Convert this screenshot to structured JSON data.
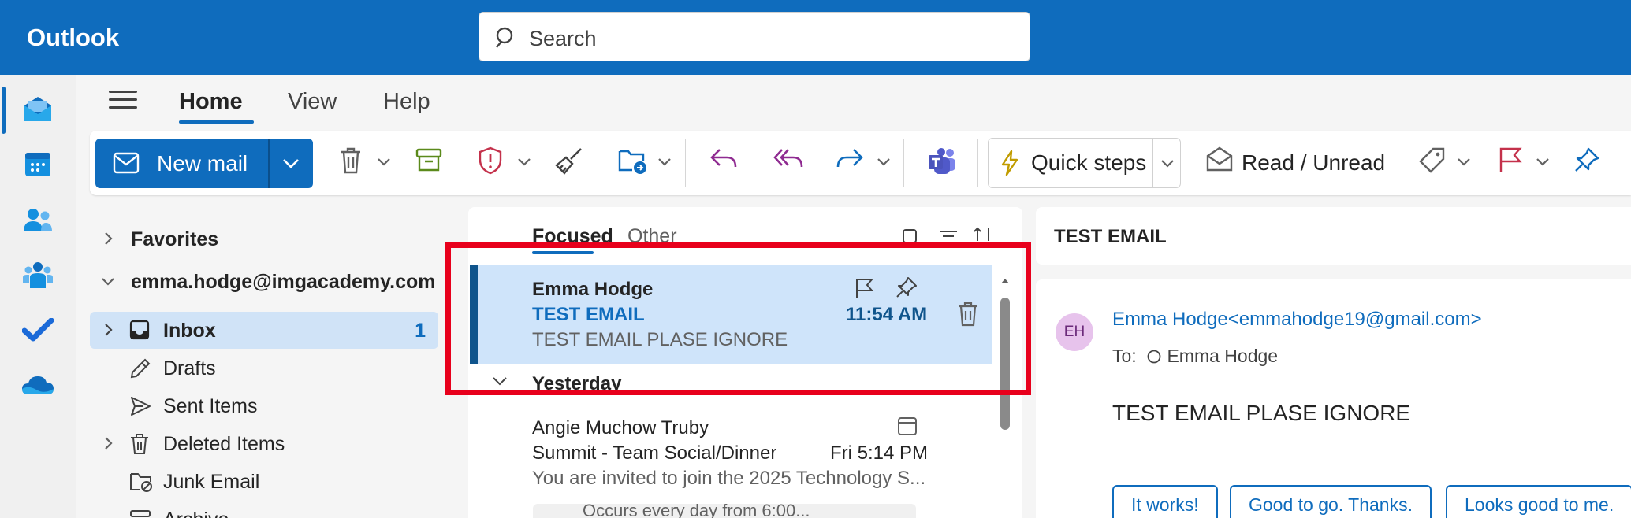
{
  "app": {
    "title": "Outlook"
  },
  "search": {
    "placeholder": "Search",
    "icon": "search-icon"
  },
  "rail": {
    "items": [
      {
        "name": "mail",
        "icon": "mail-icon",
        "active": true
      },
      {
        "name": "calendar",
        "icon": "calendar-icon"
      },
      {
        "name": "people",
        "icon": "people-icon"
      },
      {
        "name": "groups",
        "icon": "groups-icon"
      },
      {
        "name": "todo",
        "icon": "todo-check-icon"
      },
      {
        "name": "onedrive",
        "icon": "onedrive-cloud-icon"
      }
    ]
  },
  "tabs": {
    "home": "Home",
    "view": "View",
    "help": "Help"
  },
  "ribbon": {
    "new_mail": "New mail",
    "quick_steps": "Quick steps",
    "read_unread": "Read / Unread"
  },
  "folders": {
    "favorites": "Favorites",
    "account": "emma.hodge@imgacademy.com",
    "items": [
      {
        "label": "Inbox",
        "count": "1"
      },
      {
        "label": "Drafts"
      },
      {
        "label": "Sent Items"
      },
      {
        "label": "Deleted Items"
      },
      {
        "label": "Junk Email"
      },
      {
        "label": "Archive"
      }
    ]
  },
  "message_list": {
    "tabs": {
      "focused": "Focused",
      "other": "Other"
    },
    "selected": {
      "sender": "Emma Hodge",
      "subject": "TEST EMAIL",
      "time": "11:54 AM",
      "preview": "TEST EMAIL PLASE IGNORE"
    },
    "group_header": "Yesterday",
    "second": {
      "sender": "Angie Muchow Truby",
      "subject": "Summit - Team Social/Dinner",
      "time": "Fri 5:14 PM",
      "preview": "You are invited to join the 2025 Technology S...",
      "meeting": "Occurs every day from 6:00..."
    }
  },
  "reading_pane": {
    "subject": "TEST EMAIL",
    "avatar_initials": "EH",
    "sender": "Emma Hodge<emmahodge19@gmail.com>",
    "to_label": "To:",
    "to_name": "Emma Hodge",
    "body": "TEST EMAIL PLASE IGNORE",
    "quick_replies": [
      "It works!",
      "Good to go. Thanks.",
      "Looks good to me."
    ]
  },
  "colors": {
    "brand": "#0f6cbd",
    "selected_row": "#cfe4fa",
    "highlight_box": "#e8001c"
  }
}
